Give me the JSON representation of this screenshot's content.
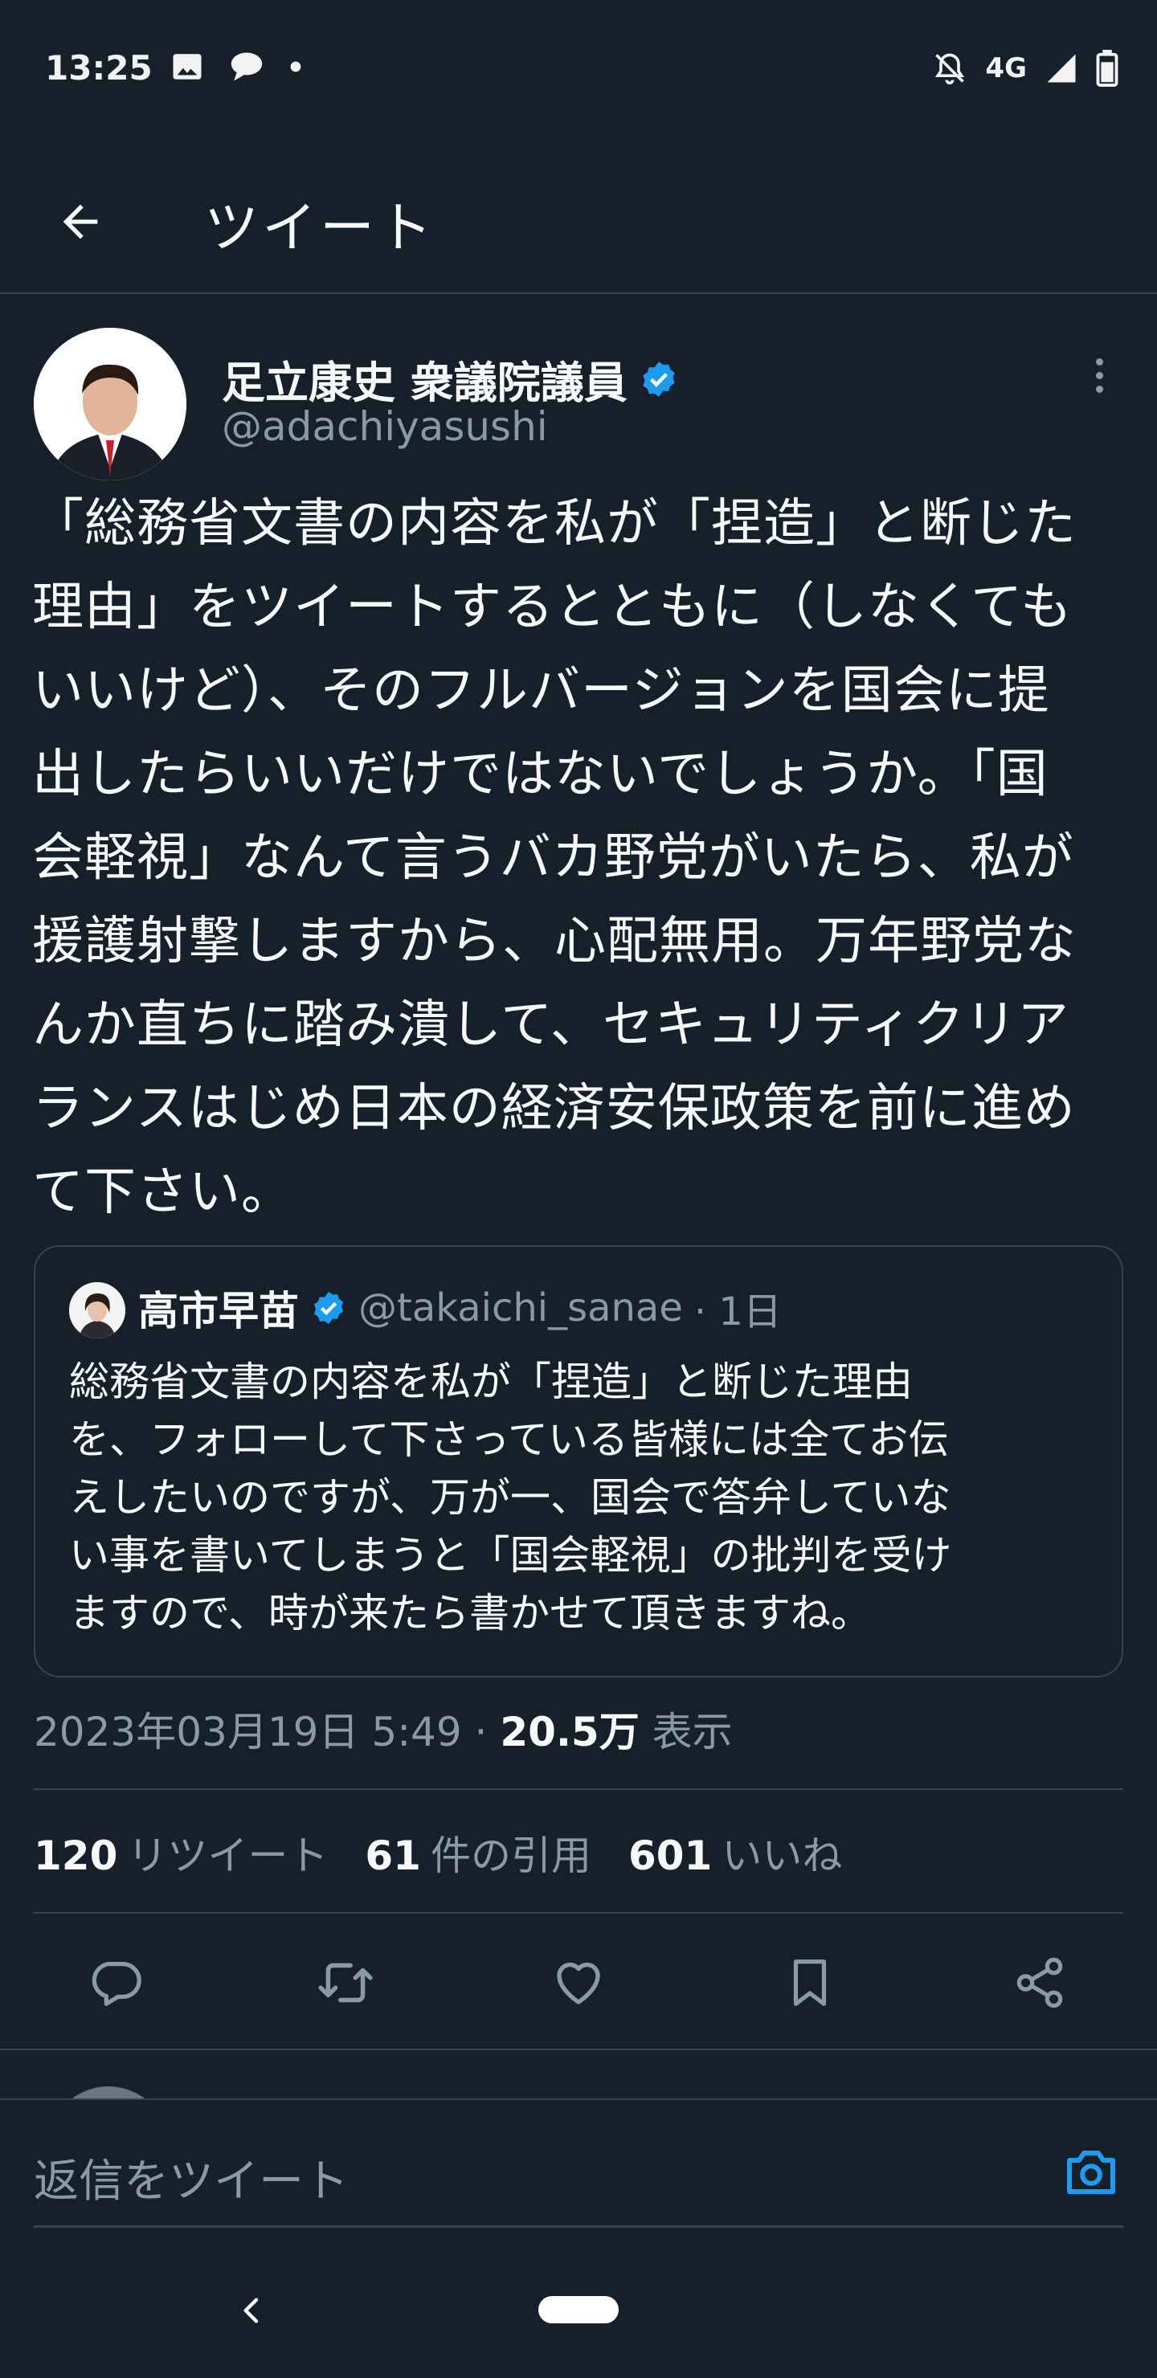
{
  "status_bar": {
    "time": "13:25",
    "network": "4G",
    "left_icons": [
      "image-icon",
      "chat-bubble-icon",
      "dot-icon"
    ],
    "right_icons": [
      "bell-off-icon",
      "signal-icon",
      "battery-icon"
    ]
  },
  "header": {
    "title": "ツイート",
    "back_icon": "arrow-left-icon"
  },
  "tweet": {
    "author_name": "足立康史 衆議院議員",
    "handle": "@adachiyasushi",
    "lines": [
      "「総務省文書の内容を私が「捏造」と断じた",
      "理由」をツイートするとともに（しなくても",
      "いいけど）、そのフルバージョンを国会に提",
      "出したらいいだけではないでしょうか。「国",
      "会軽視」なんて言うバカ野党がいたら、私が",
      "援護射撃しますから、心配無用。万年野党な",
      "んか直ちに踏み潰して、セキュリティクリア",
      "ランスはじめ日本の経済安保政策を前に進め",
      "て下さい。"
    ]
  },
  "quote": {
    "author_name": "高市早苗",
    "handle": "@takaichi_sanae",
    "time": "· 1日",
    "lines": [
      "総務省文書の内容を私が「捏造」と断じた理由",
      "を、フォローして下さっている皆様には全てお伝",
      "えしたいのですが、万が一、国会で答弁していな",
      "い事を書いてしまうと「国会軽視」の批判を受け",
      "ますので、時が来たら書かせて頂きますね。"
    ]
  },
  "meta": {
    "datetime": "2023年03月19日 5:49 · ",
    "views": "20.5万",
    "views_label": " 表示"
  },
  "stats": {
    "retweets": "120",
    "retweets_label": "リツイート",
    "quotes": "61",
    "quotes_label": "件の引用",
    "likes": "601",
    "likes_label": "いいね"
  },
  "actions": [
    "reply-icon",
    "retweet-icon",
    "like-icon",
    "bookmark-icon",
    "share-icon"
  ],
  "reply_bar": {
    "placeholder": "返信をツイート",
    "camera_icon": "camera-icon"
  },
  "colors": {
    "background": "#15202b",
    "text": "#f7f9f9",
    "secondary": "#8b98a5",
    "divider": "#38444d",
    "accent": "#1d9bf0"
  }
}
